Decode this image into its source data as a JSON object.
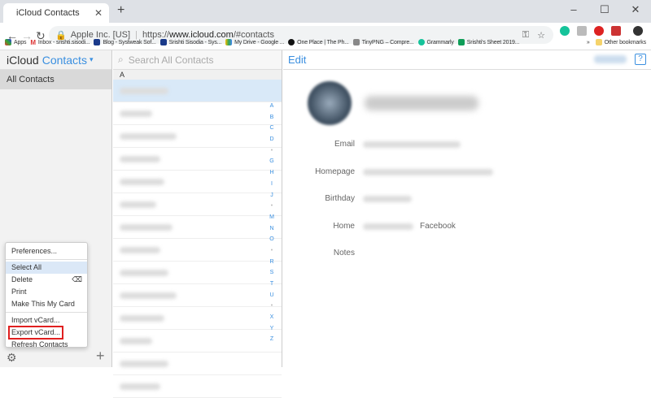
{
  "browser": {
    "tab_title": "iCloud Contacts",
    "new_tab": "+",
    "site_identity": "Apple Inc. [US]",
    "url_prefix": "https://",
    "url_host": "www.icloud.com",
    "url_path": "/#contacts",
    "bookmarks": [
      "Apps",
      "Inbox - srishti.sisodi...",
      "Blog - Systweak Sof...",
      "Srishti Sisodia - Sys...",
      "My Drive - Google ...",
      "One Place | The Ph...",
      "TinyPNG – Compre...",
      "Grammarly",
      "Srishti's Sheet 2019..."
    ],
    "other_bookmarks": "Other bookmarks",
    "more": "»"
  },
  "sidebar": {
    "brand": "iCloud",
    "app": "Contacts",
    "all_contacts": "All Contacts"
  },
  "menu": {
    "items": [
      "Preferences...",
      "Select All",
      "Delete",
      "Print",
      "Make This My Card",
      "Import vCard...",
      "Export vCard...",
      "Refresh Contacts"
    ]
  },
  "list": {
    "search_placeholder": "Search All Contacts",
    "section": "A",
    "index": [
      "A",
      "B",
      "C",
      "D",
      "•",
      "G",
      "H",
      "I",
      "J",
      "•",
      "M",
      "N",
      "O",
      "•",
      "R",
      "S",
      "T",
      "U",
      "•",
      "X",
      "Y",
      "Z"
    ]
  },
  "detail": {
    "edit": "Edit",
    "help": "?",
    "fields": {
      "email": "Email",
      "homepage": "Homepage",
      "birthday": "Birthday",
      "home": "Home",
      "notes": "Notes"
    },
    "home_suffix": "Facebook"
  },
  "colors": {
    "accent": "#3a8fe0",
    "highlight": "#e02020"
  }
}
